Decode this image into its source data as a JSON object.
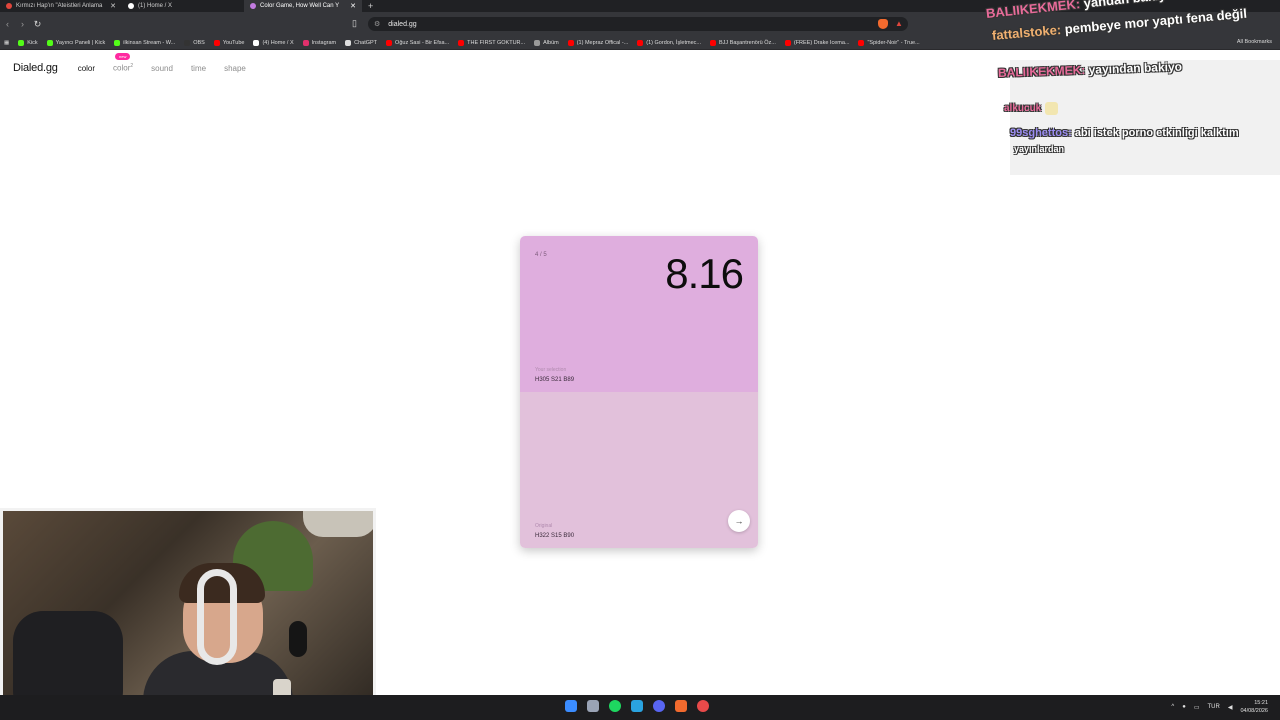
{
  "browser": {
    "tabs": [
      {
        "title": "Kırmızı Hap'ın \"Ateistleri Anlama",
        "fav_color": "#e0463c",
        "active": false
      },
      {
        "title": "(1) Home / X",
        "fav_color": "#ffffff",
        "active": false
      },
      {
        "title": "Color Game, How Well Can Y",
        "fav_color": "#c27be0",
        "active": true
      }
    ],
    "new_tab": "+",
    "url": "dialed.gg",
    "bookmarks": [
      {
        "label": "Kick",
        "color": "#53fc18"
      },
      {
        "label": "Yayıncı Paneli | Kick",
        "color": "#53fc18"
      },
      {
        "label": "ilkinsan Stream - W...",
        "color": "#53fc18"
      },
      {
        "label": "OBS",
        "color": "#333333"
      },
      {
        "label": "YouTube",
        "color": "#ff0000"
      },
      {
        "label": "(4) Home / X",
        "color": "#ffffff"
      },
      {
        "label": "Instagram",
        "color": "#e1306c"
      },
      {
        "label": "ChatGPT",
        "color": "#dddddd"
      },
      {
        "label": "Oğuz Sasi - Bir Efsa...",
        "color": "#ff0000"
      },
      {
        "label": "THE FIRST GOKTUR...",
        "color": "#ff0000"
      },
      {
        "label": "Albüm",
        "color": "#9a9a9a"
      },
      {
        "label": "(1) Mepraz Offical -...",
        "color": "#ff0000"
      },
      {
        "label": "(1) Gordon, İşletmec...",
        "color": "#ff0000"
      },
      {
        "label": "BJJ Başantrenörü Öz...",
        "color": "#ff0000"
      },
      {
        "label": "(FREE) Drake Icema...",
        "color": "#ff0000"
      },
      {
        "label": "\"Spider-Noir\" - True...",
        "color": "#ff0000"
      }
    ],
    "all_bookmarks": "All Bookmarks"
  },
  "site": {
    "logo": "Dialed.gg",
    "nav": {
      "color": "color",
      "color2": "color",
      "color2_sup": "2",
      "new_badge": "new",
      "sound": "sound",
      "time": "time",
      "shape": "shape"
    },
    "card": {
      "round": "4 / 5",
      "score": "8.16",
      "your_label": "Your selection",
      "your_value": "H305 S21 B89",
      "your_color": "#dfaede",
      "original_label": "Original",
      "original_value": "H322 S15 B90",
      "original_color": "#e2c1db",
      "next_icon": "→"
    }
  },
  "chat": {
    "messages": [
      {
        "user": "BALIIKEKMEK:",
        "text": "yandan bakiyo ama"
      },
      {
        "user": "fattalstoke:",
        "text": "pembeye mor yaptı fena değil"
      },
      {
        "user": "BALIIKEKMEK:",
        "text": "yayından bakiyo"
      },
      {
        "user": "alkucuk",
        "text": ""
      },
      {
        "user": "99sghettos:",
        "text": "abi istek porno etkinligi kalktım"
      },
      {
        "user": "",
        "text": "yayınlardan"
      }
    ]
  },
  "taskbar": {
    "icon_colors": [
      "#3b8cff",
      "#9aa3b5",
      "#1ed760",
      "#2aa3e0",
      "#5865f2",
      "#f26a2e",
      "#e84a4a"
    ],
    "lang": "TUR",
    "time": "15:21",
    "date": "04/08/2026"
  }
}
